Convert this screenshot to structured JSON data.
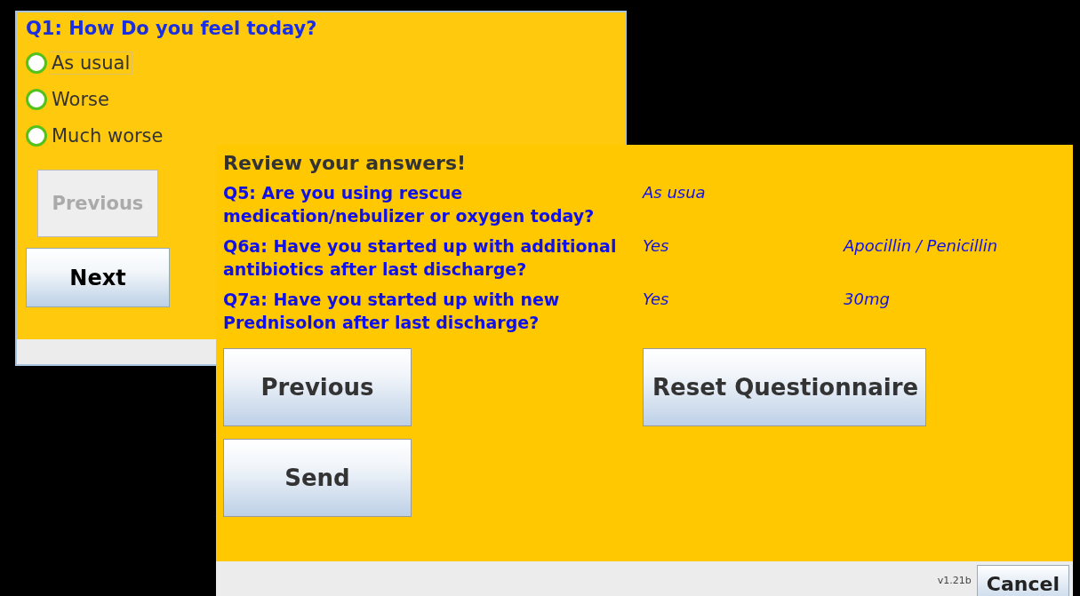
{
  "question_window": {
    "question": "Q1: How Do you feel today?",
    "options": [
      {
        "label": "As usual",
        "selected": false,
        "focused": true
      },
      {
        "label": "Worse",
        "selected": false,
        "focused": false
      },
      {
        "label": "Much worse",
        "selected": false,
        "focused": false
      }
    ],
    "buttons": [
      {
        "label": "Previous",
        "disabled": true
      },
      {
        "label": "Next",
        "disabled": false
      }
    ]
  },
  "review_window": {
    "title": "Review your answers!",
    "rows": [
      {
        "question": "Q5: Are you using rescue medication/nebulizer or oxygen today?",
        "answer": "As usua"
      },
      {
        "question": "Q6a: Have you started up with additional antibiotics after last discharge?",
        "answer": "Yes",
        "detail": "Apocillin / Penicillin"
      },
      {
        "question": "Q7a: Have you started up with new Prednisolon after last discharge?",
        "answer": "Yes",
        "detail": "30mg"
      }
    ],
    "buttons": [
      {
        "label": "Previous"
      },
      {
        "label": "Reset Questionnaire"
      },
      {
        "label": "Send"
      }
    ],
    "version": "v1.21b",
    "cancel": "Cancel"
  }
}
